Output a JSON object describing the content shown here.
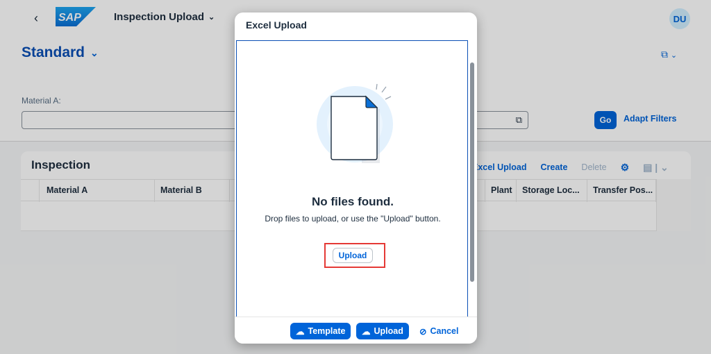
{
  "shell": {
    "back_icon": "chevron-left-icon",
    "logo_text": "SAP",
    "app_title": "Inspection Upload",
    "avatar_initials": "DU"
  },
  "page": {
    "variant": "Standard",
    "filter_label": "Material A:",
    "filter_value": "",
    "go_label": "Go",
    "adapt_label": "Adapt Filters"
  },
  "table": {
    "title": "Inspection",
    "toolbar": {
      "excel_upload": "Excel Upload",
      "create": "Create",
      "delete": "Delete"
    },
    "columns": [
      "Material A",
      "Material B",
      "",
      "",
      "Plant",
      "Storage Loc...",
      "Transfer Pos..."
    ]
  },
  "dialog": {
    "title": "Excel Upload",
    "empty_title": "No files found.",
    "empty_message": "Drop files to upload, or use the \"Upload\" button.",
    "upload_inline": "Upload",
    "footer": {
      "template": "Template",
      "upload": "Upload",
      "cancel": "Cancel"
    }
  },
  "colors": {
    "brand": "#0064d9",
    "highlight": "#e53935",
    "variant_text": "#0a4fb5"
  }
}
